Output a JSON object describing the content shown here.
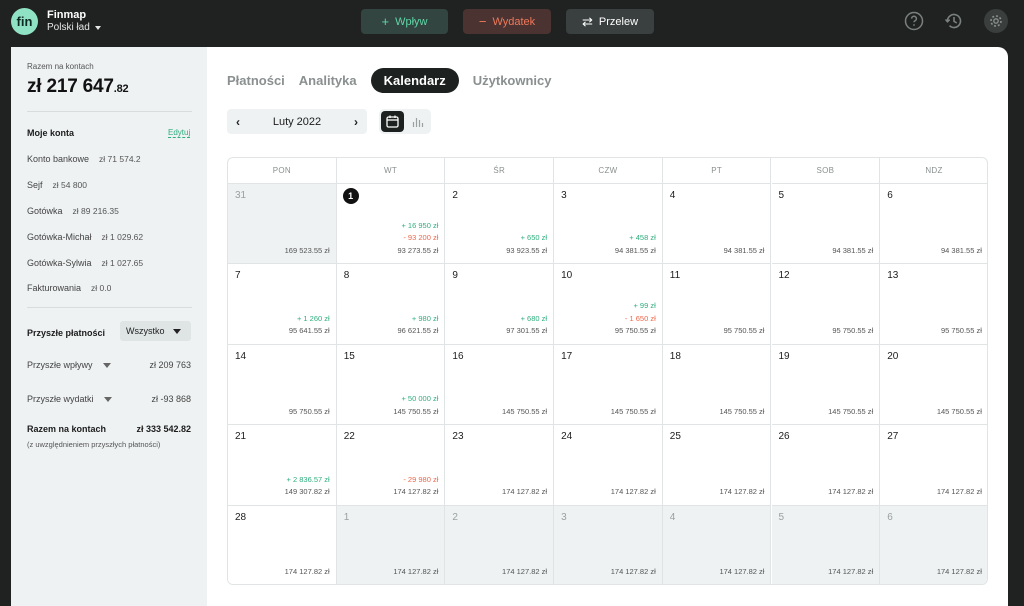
{
  "app": {
    "org_name": "Finmap",
    "org_sub": "Polski ład",
    "logo_text": "fin",
    "buttons": {
      "inflow": "Wpływ",
      "outflow": "Wydatek",
      "transfer": "Przelew"
    },
    "icons": [
      "help-icon",
      "history-icon",
      "gear-icon"
    ]
  },
  "sidebar": {
    "total_label": "Razem na kontach",
    "total_main": "zł 217 647",
    "total_dec": ".82",
    "accounts_title": "Moje konta",
    "edit_label": "Edytuj",
    "accounts": [
      {
        "name": "Konto bankowe",
        "value": "zł 71 574.2"
      },
      {
        "name": "Sejf",
        "value": "zł 54 800"
      },
      {
        "name": "Gotówka",
        "value": "zł 89 216.35"
      },
      {
        "name": "Gotówka-Michał",
        "value": "zł 1 029.62"
      },
      {
        "name": "Gotówka-Sylwia",
        "value": "zł 1 027.65"
      },
      {
        "name": "Fakturowania",
        "value": "zł 0.0"
      }
    ],
    "future_title": "Przyszłe płatności",
    "future_filter": "Wszystko",
    "future_inflows_label": "Przyszłe wpływy",
    "future_inflows_value": "zł 209 763",
    "future_outflows_label": "Przyszłe wydatki",
    "future_outflows_value": "zł -93 868",
    "sum_label": "Razem na kontach",
    "sum_value": "zł 333 542.82",
    "sum_note": "(z uwzględnieniem przyszłych płatności)"
  },
  "main": {
    "tabs": [
      {
        "label": "Płatności",
        "active": false
      },
      {
        "label": "Analityka",
        "active": false
      },
      {
        "label": "Kalendarz",
        "active": true
      },
      {
        "label": "Użytkownicy",
        "active": false
      }
    ],
    "month": "Luty 2022",
    "weekdays": [
      "PON",
      "WT",
      "ŚR",
      "CZW",
      "PT",
      "SOB",
      "NDZ"
    ],
    "weeks": [
      [
        {
          "day": "31",
          "other": true,
          "lines": [],
          "balance": "169 523.55 zł"
        },
        {
          "day": "1",
          "today": true,
          "lines": [
            {
              "t": "+ 16 950 zł",
              "k": "pos"
            },
            {
              "t": "- 93 200 zł",
              "k": "neg"
            }
          ],
          "balance": "93 273.55 zł"
        },
        {
          "day": "2",
          "lines": [
            {
              "t": "+ 650 zł",
              "k": "pos"
            }
          ],
          "balance": "93 923.55 zł"
        },
        {
          "day": "3",
          "lines": [
            {
              "t": "+ 458 zł",
              "k": "pos"
            }
          ],
          "balance": "94 381.55 zł"
        },
        {
          "day": "4",
          "lines": [],
          "balance": "94 381.55 zł"
        },
        {
          "day": "5",
          "lines": [],
          "balance": "94 381.55 zł"
        },
        {
          "day": "6",
          "lines": [],
          "balance": "94 381.55 zł"
        }
      ],
      [
        {
          "day": "7",
          "lines": [
            {
              "t": "+ 1 260 zł",
              "k": "pos"
            }
          ],
          "balance": "95 641.55 zł"
        },
        {
          "day": "8",
          "lines": [
            {
              "t": "+ 980 zł",
              "k": "pos"
            }
          ],
          "balance": "96 621.55 zł"
        },
        {
          "day": "9",
          "lines": [
            {
              "t": "+ 680 zł",
              "k": "pos"
            }
          ],
          "balance": "97 301.55 zł"
        },
        {
          "day": "10",
          "lines": [
            {
              "t": "+ 99 zł",
              "k": "pos"
            },
            {
              "t": "- 1 650 zł",
              "k": "neg"
            }
          ],
          "balance": "95 750.55 zł"
        },
        {
          "day": "11",
          "lines": [],
          "balance": "95 750.55 zł"
        },
        {
          "day": "12",
          "lines": [],
          "balance": "95 750.55 zł"
        },
        {
          "day": "13",
          "lines": [],
          "balance": "95 750.55 zł"
        }
      ],
      [
        {
          "day": "14",
          "lines": [],
          "balance": "95 750.55 zł"
        },
        {
          "day": "15",
          "lines": [
            {
              "t": "+ 50 000 zł",
              "k": "pos"
            }
          ],
          "balance": "145 750.55 zł"
        },
        {
          "day": "16",
          "lines": [],
          "balance": "145 750.55 zł"
        },
        {
          "day": "17",
          "lines": [],
          "balance": "145 750.55 zł"
        },
        {
          "day": "18",
          "lines": [],
          "balance": "145 750.55 zł"
        },
        {
          "day": "19",
          "lines": [],
          "balance": "145 750.55 zł"
        },
        {
          "day": "20",
          "lines": [],
          "balance": "145 750.55 zł"
        }
      ],
      [
        {
          "day": "21",
          "lines": [
            {
              "t": "+ 2 836.57 zł",
              "k": "pos"
            }
          ],
          "balance": "149 307.82 zł"
        },
        {
          "day": "22",
          "lines": [
            {
              "t": "- 29 980 zł",
              "k": "neg"
            }
          ],
          "balance": "174 127.82 zł"
        },
        {
          "day": "23",
          "lines": [],
          "balance": "174 127.82 zł"
        },
        {
          "day": "24",
          "lines": [],
          "balance": "174 127.82 zł"
        },
        {
          "day": "25",
          "lines": [],
          "balance": "174 127.82 zł"
        },
        {
          "day": "26",
          "lines": [],
          "balance": "174 127.82 zł"
        },
        {
          "day": "27",
          "lines": [],
          "balance": "174 127.82 zł"
        }
      ],
      [
        {
          "day": "28",
          "lines": [],
          "balance": "174 127.82 zł"
        },
        {
          "day": "1",
          "other": true,
          "lines": [],
          "balance": "174 127.82 zł"
        },
        {
          "day": "2",
          "other": true,
          "lines": [],
          "balance": "174 127.82 zł"
        },
        {
          "day": "3",
          "other": true,
          "lines": [],
          "balance": "174 127.82 zł"
        },
        {
          "day": "4",
          "other": true,
          "lines": [],
          "balance": "174 127.82 zł"
        },
        {
          "day": "5",
          "other": true,
          "lines": [],
          "balance": "174 127.82 zł"
        },
        {
          "day": "6",
          "other": true,
          "lines": [],
          "balance": "174 127.82 zł"
        }
      ]
    ]
  },
  "colors": {
    "inflow": "#2fae7e",
    "outflow": "#f0664a",
    "accent": "#8fe3c4",
    "topbar": "#1f2221"
  }
}
